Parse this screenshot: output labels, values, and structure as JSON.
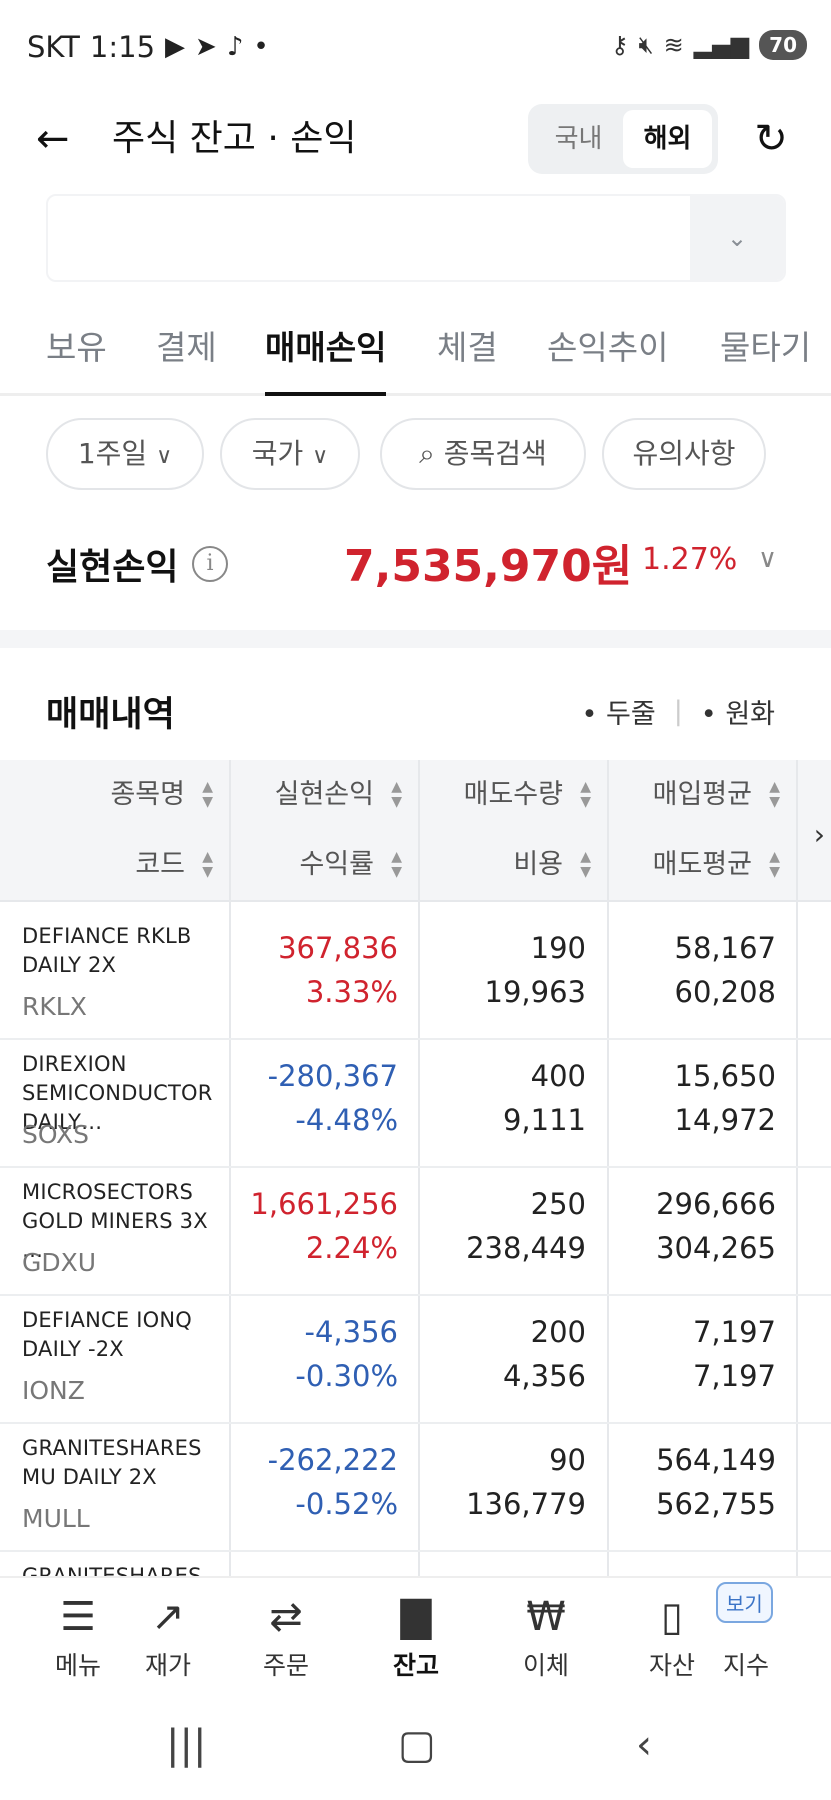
{
  "status_bar": {
    "carrier": "SKT",
    "time": "1:15",
    "battery": "70",
    "icons": [
      "youtube-icon",
      "telegram-icon",
      "tiktok-icon",
      "key-icon",
      "mute-icon",
      "wifi-icon",
      "signal-icon"
    ]
  },
  "header": {
    "title": "주식 잔고 · 손익",
    "region_domestic": "국내",
    "region_overseas": "해외"
  },
  "tabs": [
    "보유",
    "결제",
    "매매손익",
    "체결",
    "손익추이",
    "물타기"
  ],
  "filters": {
    "period": "1주일",
    "country": "국가",
    "search": "종목검색",
    "notice": "유의사항"
  },
  "summary": {
    "label": "실현손익",
    "amount": "7,535,970원",
    "rate": "1.27%"
  },
  "history": {
    "title": "매매내역",
    "opt_two_line": "두줄",
    "opt_krw": "원화"
  },
  "table": {
    "headers_row1": [
      "종목명",
      "실현손익",
      "매도수량",
      "매입평균"
    ],
    "headers_row2": [
      "코드",
      "수익률",
      "비용",
      "매도평균"
    ],
    "rows": [
      {
        "name": "DEFIANCE RKLB DAILY 2X",
        "code": "RKLX",
        "pnl": "367,836",
        "rate": "3.33%",
        "qty": "190",
        "cost": "19,963",
        "buy_avg": "58,167",
        "sell_avg": "60,208",
        "dir": "up"
      },
      {
        "name": "DIREXION SEMICONDUCTOR DAILY…",
        "code": "SOXS",
        "pnl": "-280,367",
        "rate": "-4.48%",
        "qty": "400",
        "cost": "9,111",
        "buy_avg": "15,650",
        "sell_avg": "14,972",
        "dir": "down"
      },
      {
        "name": "MICROSECTORS GOLD MINERS 3X …",
        "code": "GDXU",
        "pnl": "1,661,256",
        "rate": "2.24%",
        "qty": "250",
        "cost": "238,449",
        "buy_avg": "296,666",
        "sell_avg": "304,265",
        "dir": "up"
      },
      {
        "name": "DEFIANCE IONQ DAILY -2X",
        "code": "IONZ",
        "pnl": "-4,356",
        "rate": "-0.30%",
        "qty": "200",
        "cost": "4,356",
        "buy_avg": "7,197",
        "sell_avg": "7,197",
        "dir": "down"
      },
      {
        "name": "GRANITESHARES MU DAILY 2X",
        "code": "MULL",
        "pnl": "-262,222",
        "rate": "-0.52%",
        "qty": "90",
        "cost": "136,779",
        "buy_avg": "564,149",
        "sell_avg": "562,755",
        "dir": "down"
      },
      {
        "name": "GRANITESHARES",
        "code": "",
        "pnl": "",
        "rate": "",
        "qty": "",
        "cost": "",
        "buy_avg": "",
        "sell_avg": "",
        "dir": "up"
      }
    ]
  },
  "bottom_nav": {
    "items": [
      "메뉴",
      "재가",
      "주문",
      "잔고",
      "이체",
      "자산",
      "지수"
    ],
    "badge": "보기"
  },
  "colors": {
    "up": "#d0232e",
    "down": "#2f5fb3"
  }
}
